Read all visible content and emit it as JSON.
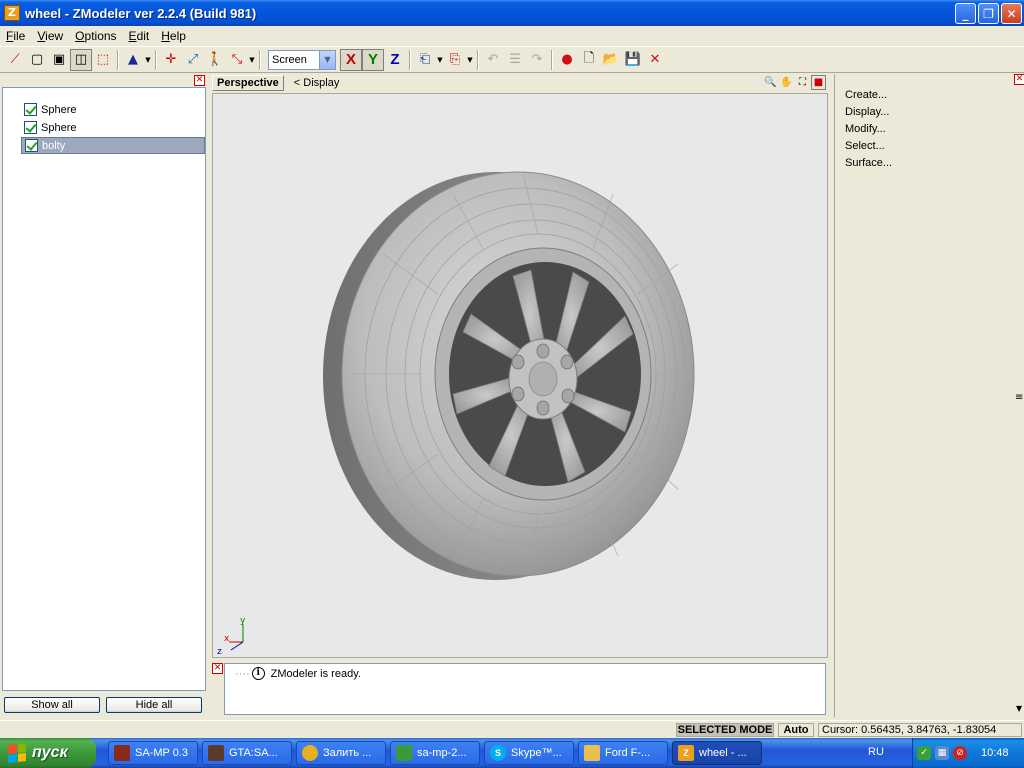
{
  "window": {
    "title": "wheel - ZModeler ver 2.2.4 (Build 981)",
    "app_icon_letter": "Z"
  },
  "menu": [
    "File",
    "View",
    "Options",
    "Edit",
    "Help"
  ],
  "toolbar": {
    "space_select": "Screen",
    "axis_x": "X",
    "axis_y": "Y",
    "axis_z": "Z"
  },
  "tree": {
    "items": [
      {
        "label": "Sphere",
        "checked": true,
        "selected": false
      },
      {
        "label": "Sphere",
        "checked": true,
        "selected": false
      },
      {
        "label": "bolty",
        "checked": true,
        "selected": true
      }
    ],
    "show_all": "Show all",
    "hide_all": "Hide all"
  },
  "viewport": {
    "view_name": "Perspective",
    "display_label": "<  Display",
    "axis_labels": {
      "x": "x",
      "y": "y",
      "z": "z"
    }
  },
  "log": {
    "message": "ZModeler is ready."
  },
  "commands": [
    "Create...",
    "Display...",
    "Modify...",
    "Select...",
    "Surface..."
  ],
  "status": {
    "mode": "SELECTED MODE",
    "auto": "Auto",
    "cursor": "Cursor: 0.56435, 3.84763, -1.83054"
  },
  "taskbar": {
    "start_label": "пуск",
    "buttons": [
      {
        "label": "SA-MP 0.3",
        "icon_color": "#8a2a1a"
      },
      {
        "label": "GTA:SA...",
        "icon_color": "#5a3a2a"
      },
      {
        "label": "Залить ...",
        "icon_color": "#e8b020"
      },
      {
        "label": "sa-mp-2...",
        "icon_color": "#3a9a3a"
      },
      {
        "label": "Skype™...",
        "icon_color": "#00aff0"
      },
      {
        "label": "Ford F-...",
        "icon_color": "#e8c050"
      },
      {
        "label": "wheel - ...",
        "icon_color": "#e8a020"
      }
    ],
    "language": "RU",
    "clock": "10:48"
  }
}
